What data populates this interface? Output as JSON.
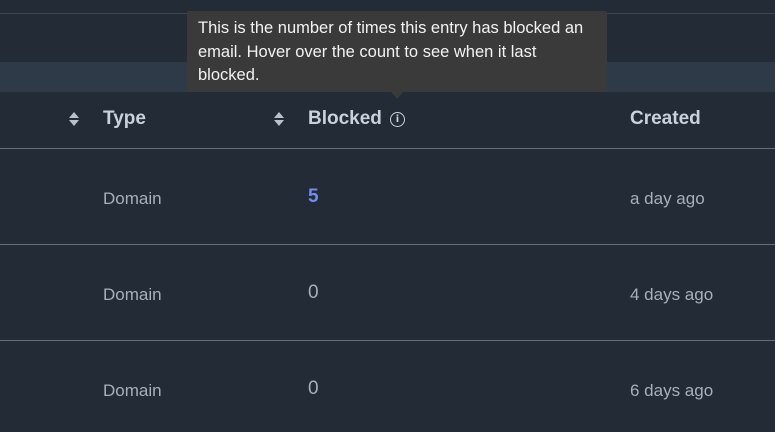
{
  "table": {
    "columns": [
      {
        "label": "Type"
      },
      {
        "label": "Blocked"
      },
      {
        "label": "Created"
      }
    ],
    "info_icon_glyph": "i",
    "rows": [
      {
        "type": "Domain",
        "blocked": "5",
        "created": "a day ago"
      },
      {
        "type": "Domain",
        "blocked": "0",
        "created": "4 days ago"
      },
      {
        "type": "Domain",
        "blocked": "0",
        "created": "6 days ago"
      }
    ]
  },
  "tooltip": {
    "text": "This is the number of times this entry has blocked an email. Hover over the count to see when it last blocked."
  },
  "colors": {
    "background": "#222b36",
    "link": "#6f8ee8",
    "tooltip_bg": "#3a3a3a"
  }
}
